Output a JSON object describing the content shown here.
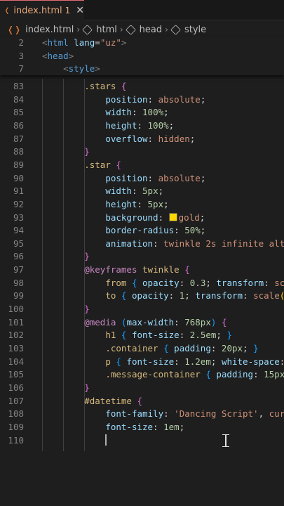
{
  "tab": {
    "icon": "html5-icon",
    "filename": "index.html",
    "badge": "1",
    "close": "✕"
  },
  "breadcrumb": {
    "file": "index.html",
    "items": [
      "html",
      "head",
      "style"
    ]
  },
  "sticky_lines": [
    {
      "n": "2",
      "parts": [
        [
          "punct",
          "<"
        ],
        [
          "tag",
          "html"
        ],
        [
          "plain",
          " "
        ],
        [
          "attr",
          "lang"
        ],
        [
          "plain",
          "="
        ],
        [
          "str",
          "\"uz\""
        ],
        [
          "punct",
          ">"
        ]
      ]
    },
    {
      "n": "3",
      "parts": [
        [
          "punct",
          "<"
        ],
        [
          "tag",
          "head"
        ],
        [
          "punct",
          ">"
        ]
      ]
    },
    {
      "n": "7",
      "parts": [
        [
          "plain",
          "    "
        ],
        [
          "punct",
          "<"
        ],
        [
          "tag",
          "style"
        ],
        [
          "punct",
          ">"
        ]
      ]
    }
  ],
  "lines": [
    {
      "n": "83",
      "parts": [
        [
          "plain",
          "        "
        ],
        [
          "sel",
          ".stars"
        ],
        [
          "plain",
          " "
        ],
        [
          "br2",
          "{"
        ]
      ]
    },
    {
      "n": "84",
      "parts": [
        [
          "plain",
          "            "
        ],
        [
          "prop",
          "position"
        ],
        [
          "plain",
          ": "
        ],
        [
          "val",
          "absolute"
        ],
        [
          "plain",
          ";"
        ]
      ]
    },
    {
      "n": "85",
      "parts": [
        [
          "plain",
          "            "
        ],
        [
          "prop",
          "width"
        ],
        [
          "plain",
          ": "
        ],
        [
          "num",
          "100%"
        ],
        [
          "plain",
          ";"
        ]
      ]
    },
    {
      "n": "86",
      "parts": [
        [
          "plain",
          "            "
        ],
        [
          "prop",
          "height"
        ],
        [
          "plain",
          ": "
        ],
        [
          "num",
          "100%"
        ],
        [
          "plain",
          ";"
        ]
      ]
    },
    {
      "n": "87",
      "parts": [
        [
          "plain",
          "            "
        ],
        [
          "prop",
          "overflow"
        ],
        [
          "plain",
          ": "
        ],
        [
          "val",
          "hidden"
        ],
        [
          "plain",
          ";"
        ]
      ]
    },
    {
      "n": "88",
      "parts": [
        [
          "plain",
          "        "
        ],
        [
          "br2",
          "}"
        ]
      ]
    },
    {
      "n": "89",
      "parts": [
        [
          "plain",
          "        "
        ],
        [
          "sel",
          ".star"
        ],
        [
          "plain",
          " "
        ],
        [
          "br2",
          "{"
        ]
      ]
    },
    {
      "n": "90",
      "parts": [
        [
          "plain",
          "            "
        ],
        [
          "prop",
          "position"
        ],
        [
          "plain",
          ": "
        ],
        [
          "val",
          "absolute"
        ],
        [
          "plain",
          ";"
        ]
      ]
    },
    {
      "n": "91",
      "parts": [
        [
          "plain",
          "            "
        ],
        [
          "prop",
          "width"
        ],
        [
          "plain",
          ": "
        ],
        [
          "num",
          "5px"
        ],
        [
          "plain",
          ";"
        ]
      ]
    },
    {
      "n": "92",
      "parts": [
        [
          "plain",
          "            "
        ],
        [
          "prop",
          "height"
        ],
        [
          "plain",
          ": "
        ],
        [
          "num",
          "5px"
        ],
        [
          "plain",
          ";"
        ]
      ]
    },
    {
      "n": "93",
      "parts": [
        [
          "plain",
          "            "
        ],
        [
          "prop",
          "background"
        ],
        [
          "plain",
          ": "
        ],
        [
          "swatch",
          ""
        ],
        [
          "val",
          "gold"
        ],
        [
          "plain",
          ";"
        ]
      ]
    },
    {
      "n": "94",
      "parts": [
        [
          "plain",
          "            "
        ],
        [
          "prop",
          "border-radius"
        ],
        [
          "plain",
          ": "
        ],
        [
          "num",
          "50%"
        ],
        [
          "plain",
          ";"
        ]
      ]
    },
    {
      "n": "95",
      "parts": [
        [
          "plain",
          "            "
        ],
        [
          "prop",
          "animation"
        ],
        [
          "plain",
          ": "
        ],
        [
          "val",
          "twinkle 2s infinite alt"
        ]
      ]
    },
    {
      "n": "96",
      "parts": [
        [
          "plain",
          "        "
        ],
        [
          "br2",
          "}"
        ]
      ]
    },
    {
      "n": "97",
      "parts": [
        [
          "plain",
          "        "
        ],
        [
          "at",
          "@keyframes"
        ],
        [
          "plain",
          " "
        ],
        [
          "sel",
          "twinkle"
        ],
        [
          "plain",
          " "
        ],
        [
          "br2",
          "{"
        ]
      ]
    },
    {
      "n": "98",
      "parts": [
        [
          "plain",
          "            "
        ],
        [
          "sel",
          "from"
        ],
        [
          "plain",
          " "
        ],
        [
          "br3",
          "{"
        ],
        [
          "plain",
          " "
        ],
        [
          "prop",
          "opacity"
        ],
        [
          "plain",
          ": "
        ],
        [
          "num",
          "0.3"
        ],
        [
          "plain",
          "; "
        ],
        [
          "prop",
          "transform"
        ],
        [
          "plain",
          ": "
        ],
        [
          "val",
          "sc"
        ]
      ]
    },
    {
      "n": "99",
      "parts": [
        [
          "plain",
          "            "
        ],
        [
          "sel",
          "to"
        ],
        [
          "plain",
          " "
        ],
        [
          "br3",
          "{"
        ],
        [
          "plain",
          " "
        ],
        [
          "prop",
          "opacity"
        ],
        [
          "plain",
          ": "
        ],
        [
          "num",
          "1"
        ],
        [
          "plain",
          "; "
        ],
        [
          "prop",
          "transform"
        ],
        [
          "plain",
          ": "
        ],
        [
          "val",
          "scale"
        ],
        [
          "br1",
          "("
        ]
      ]
    },
    {
      "n": "100",
      "parts": [
        [
          "plain",
          "        "
        ],
        [
          "br2",
          "}"
        ]
      ]
    },
    {
      "n": "101",
      "parts": [
        [
          "plain",
          "        "
        ],
        [
          "at",
          "@media"
        ],
        [
          "plain",
          " "
        ],
        [
          "br3",
          "("
        ],
        [
          "prop",
          "max-width"
        ],
        [
          "plain",
          ": "
        ],
        [
          "num",
          "768px"
        ],
        [
          "br3",
          ")"
        ],
        [
          "plain",
          " "
        ],
        [
          "br2",
          "{"
        ]
      ]
    },
    {
      "n": "102",
      "parts": [
        [
          "plain",
          "            "
        ],
        [
          "sel",
          "h1"
        ],
        [
          "plain",
          " "
        ],
        [
          "br3",
          "{"
        ],
        [
          "plain",
          " "
        ],
        [
          "prop",
          "font-size"
        ],
        [
          "plain",
          ": "
        ],
        [
          "num",
          "2.5em"
        ],
        [
          "plain",
          "; "
        ],
        [
          "br3",
          "}"
        ]
      ]
    },
    {
      "n": "103",
      "parts": [
        [
          "plain",
          "            "
        ],
        [
          "sel",
          ".container"
        ],
        [
          "plain",
          " "
        ],
        [
          "br3",
          "{"
        ],
        [
          "plain",
          " "
        ],
        [
          "prop",
          "padding"
        ],
        [
          "plain",
          ": "
        ],
        [
          "num",
          "20px"
        ],
        [
          "plain",
          "; "
        ],
        [
          "br3",
          "}"
        ]
      ]
    },
    {
      "n": "104",
      "parts": [
        [
          "plain",
          "            "
        ],
        [
          "sel",
          "p"
        ],
        [
          "plain",
          " "
        ],
        [
          "br3",
          "{"
        ],
        [
          "plain",
          " "
        ],
        [
          "prop",
          "font-size"
        ],
        [
          "plain",
          ": "
        ],
        [
          "num",
          "1.2em"
        ],
        [
          "plain",
          "; "
        ],
        [
          "prop",
          "white-space"
        ],
        [
          "plain",
          ":"
        ]
      ]
    },
    {
      "n": "105",
      "parts": [
        [
          "plain",
          "            "
        ],
        [
          "sel",
          ".message-container"
        ],
        [
          "plain",
          " "
        ],
        [
          "br3",
          "{"
        ],
        [
          "plain",
          " "
        ],
        [
          "prop",
          "padding"
        ],
        [
          "plain",
          ": "
        ],
        [
          "num",
          "15px"
        ]
      ]
    },
    {
      "n": "106",
      "parts": [
        [
          "plain",
          "        "
        ],
        [
          "br2",
          "}"
        ]
      ]
    },
    {
      "n": "107",
      "parts": [
        [
          "plain",
          "        "
        ],
        [
          "sel",
          "#datetime"
        ],
        [
          "plain",
          " "
        ],
        [
          "br2",
          "{"
        ]
      ]
    },
    {
      "n": "108",
      "parts": [
        [
          "plain",
          "            "
        ],
        [
          "prop",
          "font-family"
        ],
        [
          "plain",
          ": "
        ],
        [
          "val",
          "'Dancing Script'"
        ],
        [
          "plain",
          ", "
        ],
        [
          "val",
          "cur"
        ]
      ]
    },
    {
      "n": "109",
      "parts": [
        [
          "plain",
          "            "
        ],
        [
          "prop",
          "font-size"
        ],
        [
          "plain",
          ": "
        ],
        [
          "num",
          "1em"
        ],
        [
          "plain",
          ";"
        ]
      ]
    },
    {
      "n": "110",
      "parts": [
        [
          "plain",
          "            "
        ],
        [
          "caret",
          ""
        ]
      ]
    }
  ]
}
